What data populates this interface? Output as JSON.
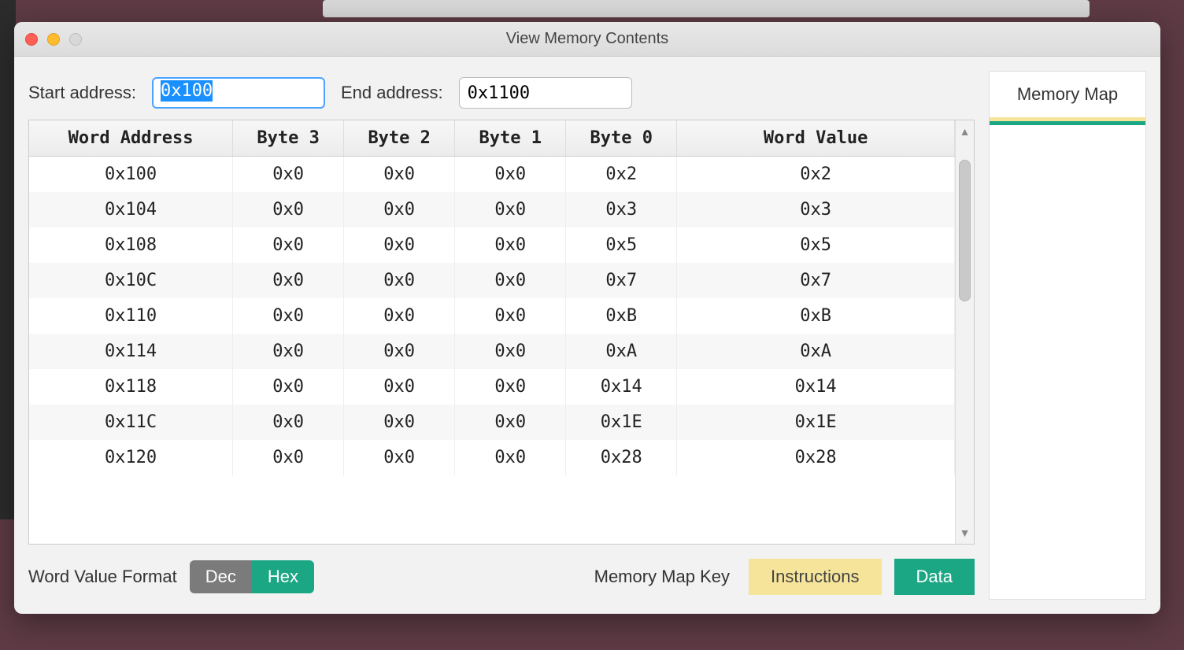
{
  "window": {
    "title": "View Memory Contents"
  },
  "inputs": {
    "start_label": "Start address:",
    "start_value": "0x100",
    "end_label": "End address:",
    "end_value": "0x1100"
  },
  "columns": [
    "Word Address",
    "Byte 3",
    "Byte 2",
    "Byte 1",
    "Byte 0",
    "Word Value"
  ],
  "rows": [
    {
      "addr": "0x100",
      "b3": "0x0",
      "b2": "0x0",
      "b1": "0x0",
      "b0": "0x2",
      "val": "0x2"
    },
    {
      "addr": "0x104",
      "b3": "0x0",
      "b2": "0x0",
      "b1": "0x0",
      "b0": "0x3",
      "val": "0x3"
    },
    {
      "addr": "0x108",
      "b3": "0x0",
      "b2": "0x0",
      "b1": "0x0",
      "b0": "0x5",
      "val": "0x5"
    },
    {
      "addr": "0x10C",
      "b3": "0x0",
      "b2": "0x0",
      "b1": "0x0",
      "b0": "0x7",
      "val": "0x7"
    },
    {
      "addr": "0x110",
      "b3": "0x0",
      "b2": "0x0",
      "b1": "0x0",
      "b0": "0xB",
      "val": "0xB"
    },
    {
      "addr": "0x114",
      "b3": "0x0",
      "b2": "0x0",
      "b1": "0x0",
      "b0": "0xA",
      "val": "0xA"
    },
    {
      "addr": "0x118",
      "b3": "0x0",
      "b2": "0x0",
      "b1": "0x0",
      "b0": "0x14",
      "val": "0x14"
    },
    {
      "addr": "0x11C",
      "b3": "0x0",
      "b2": "0x0",
      "b1": "0x0",
      "b0": "0x1E",
      "val": "0x1E"
    },
    {
      "addr": "0x120",
      "b3": "0x0",
      "b2": "0x0",
      "b1": "0x0",
      "b0": "0x28",
      "val": "0x28"
    }
  ],
  "footer": {
    "format_label": "Word Value Format",
    "dec": "Dec",
    "hex": "Hex",
    "key_label": "Memory Map Key",
    "instructions": "Instructions",
    "data": "Data"
  },
  "side": {
    "title": "Memory Map"
  },
  "colors": {
    "teal": "#1ba784",
    "yellow": "#f5e49a",
    "gray": "#7b7b7b"
  }
}
